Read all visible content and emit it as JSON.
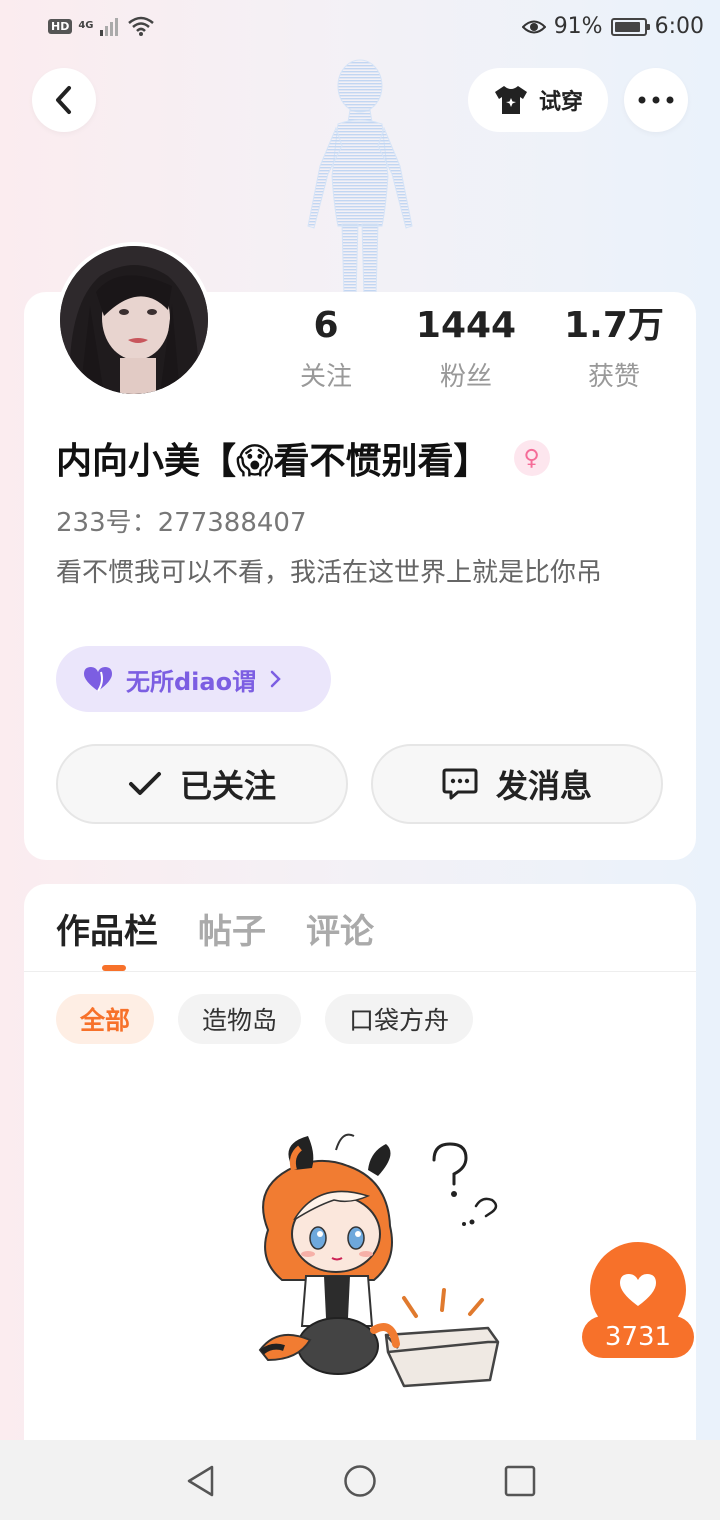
{
  "status_bar": {
    "hd_label": "HD",
    "network_label": "4G",
    "battery_percent": "91%",
    "battery_level": 0.91,
    "time": "6:00"
  },
  "header": {
    "back_icon": "chevron-left-icon",
    "try_on_label": "试穿",
    "more_icon": "ellipsis-icon"
  },
  "profile": {
    "stats": [
      {
        "value": "6",
        "label": "关注"
      },
      {
        "value": "1444",
        "label": "粉丝"
      },
      {
        "value": "1.7万",
        "label": "获赞"
      }
    ],
    "name": "内向小美【😱看不惯别看】",
    "gender_icon": "female-icon",
    "gender_symbol": "♀",
    "id_line": "233号：277388407",
    "bio": "看不惯我可以不看，我活在这世界上就是比你吊",
    "tag_label": "无所diao谓",
    "follow_button": "已关注",
    "message_button": "发消息"
  },
  "works": {
    "tabs": [
      "作品栏",
      "帖子",
      "评论"
    ],
    "active_tab": 0,
    "filters": [
      "全部",
      "造物岛",
      "口袋方舟"
    ],
    "active_filter": 0
  },
  "like_fab": {
    "count": "3731"
  },
  "colors": {
    "accent": "#f7712a",
    "tag_purple": "#7c5ee2",
    "gender_pink": "#f56c98"
  }
}
